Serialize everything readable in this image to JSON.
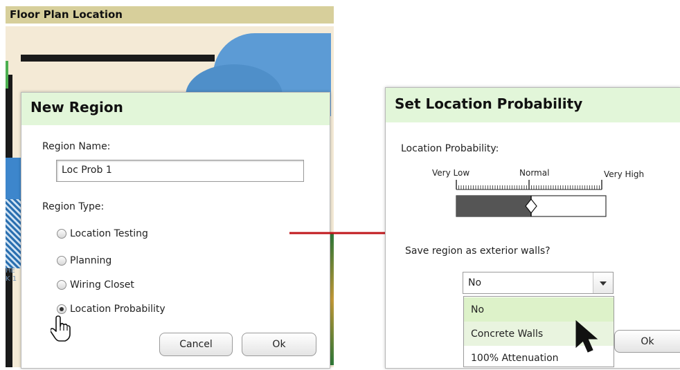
{
  "floor_plan": {
    "title": "Floor Plan Location",
    "side_text": "HE\nK 1"
  },
  "new_region_dialog": {
    "title": "New Region",
    "region_name_label": "Region Name:",
    "region_name_value": "Loc Prob 1",
    "region_type_label": "Region Type:",
    "region_types": [
      {
        "label": "Location Testing",
        "selected": false
      },
      {
        "label": "Planning",
        "selected": false
      },
      {
        "label": "Wiring Closet",
        "selected": false
      },
      {
        "label": "Location Probability",
        "selected": true
      }
    ],
    "cancel_label": "Cancel",
    "ok_label": "Ok"
  },
  "set_location_dialog": {
    "title": "Set Location Probability",
    "probability_label": "Location Probability:",
    "scale_low": "Very Low",
    "scale_mid": "Normal",
    "scale_high": "Very High",
    "slider_value_fraction": 0.5,
    "exterior_walls_question": "Save region as exterior walls?",
    "select_value": "No",
    "options": [
      "No",
      "Concrete Walls",
      "100% Attenuation"
    ],
    "ok_label": "Ok"
  },
  "colors": {
    "dialog_header": "#e2f6d9",
    "floor_plan_title": "#d7cf9b",
    "arrow": "#c0161b",
    "slider_fill": "#555555"
  }
}
